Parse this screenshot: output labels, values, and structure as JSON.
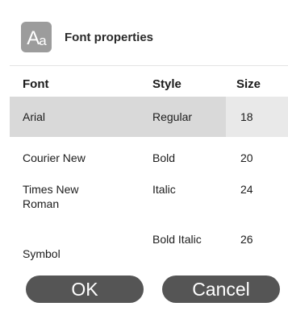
{
  "header": {
    "icon_text_big": "A",
    "icon_text_small": "a",
    "title": "Font properties"
  },
  "columns": {
    "font": "Font",
    "style": "Style",
    "size": "Size"
  },
  "rows": [
    {
      "font": "Arial",
      "style": "Regular",
      "size": "18",
      "selected": true
    },
    {
      "font": "Courier New",
      "style": "Bold",
      "size": "20",
      "selected": false
    },
    {
      "font": "Times New Roman",
      "style": "Italic",
      "size": "24",
      "selected": false
    },
    {
      "font": "Symbol",
      "style": "Bold Italic",
      "size": "26",
      "selected": false
    }
  ],
  "buttons": {
    "ok": "OK",
    "cancel": "Cancel"
  },
  "colors": {
    "selected_row": "#d9d9d9",
    "button_bg": "#555555",
    "icon_bg": "#9c9c9c"
  }
}
